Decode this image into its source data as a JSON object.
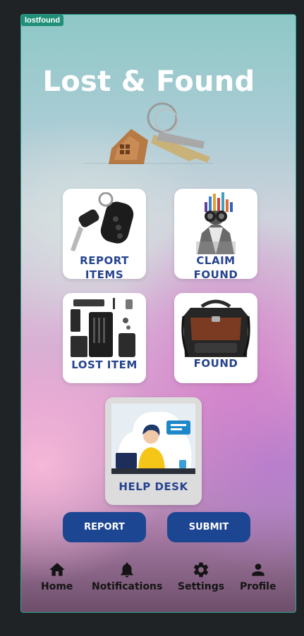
{
  "app": {
    "badge": "lostfound",
    "title": "Lost & Found"
  },
  "tiles": {
    "report_items": "REPORT ITEMS",
    "claim_found": "CLAIM FOUND",
    "lost_item": "LOST ITEM",
    "found": "FOUND",
    "help_desk": "HELP DESK"
  },
  "buttons": {
    "report": "REPORT",
    "submit": "SUBMIT"
  },
  "nav": {
    "items": [
      {
        "label": "Home",
        "icon": "home-icon"
      },
      {
        "label": "Notifications",
        "icon": "bell-icon"
      },
      {
        "label": "Settings",
        "icon": "gear-icon"
      },
      {
        "label": "Profile",
        "icon": "person-icon"
      }
    ]
  },
  "colors": {
    "accent": "#1c4592",
    "tile_text": "#25438f",
    "badge": "#1f8f78"
  }
}
